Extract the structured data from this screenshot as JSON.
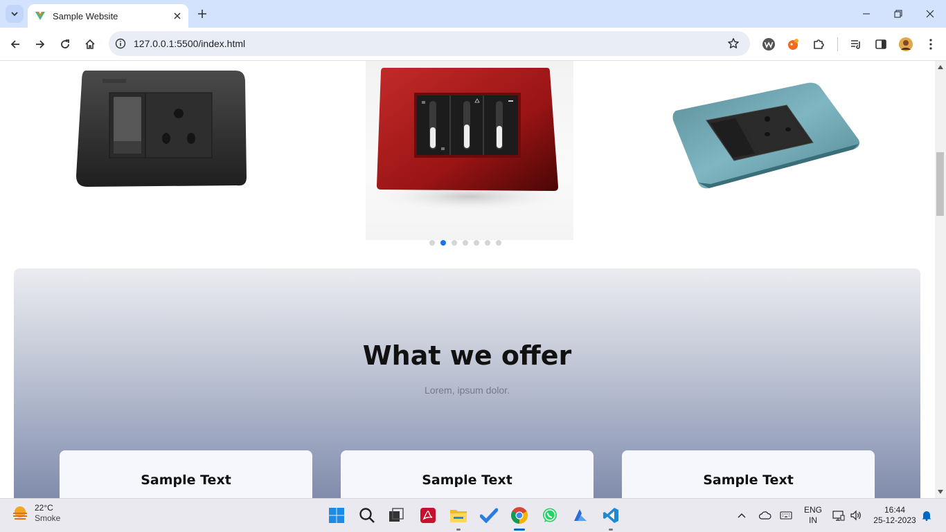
{
  "browser": {
    "tab_title": "Sample Website",
    "url": "127.0.0.1:5500/index.html"
  },
  "carousel": {
    "slides": [
      "black-socket-switch-plate",
      "red-triple-slider-switch-plate",
      "teal-socket-switch-plate"
    ],
    "dot_count": 7,
    "active_dot": 1
  },
  "offer": {
    "title": "What we offer",
    "subtitle": "Lorem, ipsum dolor.",
    "cards": [
      {
        "title": "Sample Text"
      },
      {
        "title": "Sample Text"
      },
      {
        "title": "Sample Text"
      }
    ]
  },
  "taskbar": {
    "weather": {
      "temp": "22°C",
      "condition": "Smoke"
    },
    "language": {
      "lang": "ENG",
      "region": "IN"
    },
    "clock": {
      "time": "16:44",
      "date": "25-12-2023"
    },
    "apps": [
      "start-icon",
      "search-icon",
      "task-view-icon",
      "acrobat-icon",
      "file-explorer-icon",
      "todo-icon",
      "chrome-icon",
      "whatsapp-icon",
      "azure-data-studio-icon",
      "vscode-icon"
    ]
  },
  "colors": {
    "accent": "#1a73e8",
    "tabbar": "#d3e3fd",
    "red_plate": "#a81b1b",
    "teal_plate": "#6aa6b2"
  }
}
